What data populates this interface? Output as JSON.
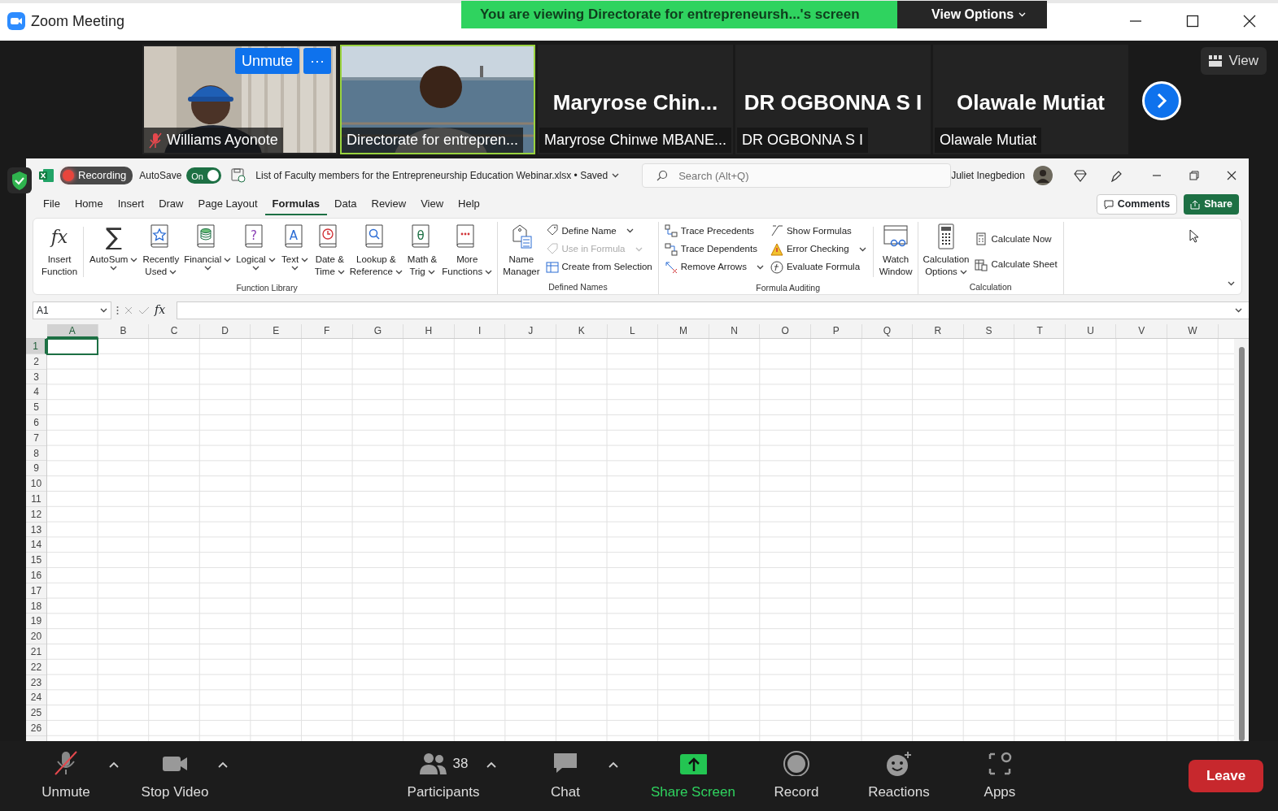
{
  "window": {
    "title": "Zoom Meeting"
  },
  "share_banner": {
    "text": "You are viewing Directorate for entrepreneursh...'s screen",
    "view_options": "View Options"
  },
  "participants": [
    {
      "kind": "video",
      "name": "Williams Ayonote",
      "muted": true,
      "active_speaker": false,
      "buttons": [
        "Unmute",
        "···"
      ]
    },
    {
      "kind": "video",
      "name": "Directorate for entrepren...",
      "muted": false,
      "active_speaker": true
    },
    {
      "kind": "name",
      "title": "Maryrose  Chin...",
      "name": "Maryrose Chinwe MBANE...",
      "muted": false,
      "active_speaker": false
    },
    {
      "kind": "name",
      "title": "DR OGBONNA S I",
      "name": "DR OGBONNA S I",
      "muted": false,
      "active_speaker": false
    },
    {
      "kind": "name",
      "title": "Olawale Mutiat",
      "name": "Olawale Mutiat",
      "muted": false,
      "active_speaker": false
    }
  ],
  "view_button": "View",
  "shared_screen": {
    "recording": "Recording",
    "excel": {
      "autosave": {
        "label": "AutoSave",
        "on": true,
        "state": "On"
      },
      "document_title": "List of Faculty members for the Entrepreneurship Education Webinar.xlsx • Saved",
      "search": {
        "placeholder": "Search (Alt+Q)"
      },
      "user": "Juliet Inegbedion",
      "tabs": [
        {
          "label": "File",
          "selected": false
        },
        {
          "label": "Home",
          "selected": false
        },
        {
          "label": "Insert",
          "selected": false
        },
        {
          "label": "Draw",
          "selected": false
        },
        {
          "label": "Page Layout",
          "selected": false
        },
        {
          "label": "Formulas",
          "selected": true
        },
        {
          "label": "Data",
          "selected": false
        },
        {
          "label": "Review",
          "selected": false
        },
        {
          "label": "View",
          "selected": false
        },
        {
          "label": "Help",
          "selected": false
        }
      ],
      "comments": "Comments",
      "share": "Share",
      "ribbon": [
        {
          "title": "Function Library",
          "items": [
            {
              "kind": "large",
              "label": [
                "Insert",
                "Function"
              ],
              "dropdown": false,
              "glyph": "fx"
            },
            {
              "kind": "separator"
            },
            {
              "kind": "large",
              "label": [
                "AutoSum"
              ],
              "dropdown": true,
              "glyph": "∑"
            },
            {
              "kind": "large",
              "label": [
                "Recently",
                "Used"
              ],
              "dropdown": true
            },
            {
              "kind": "large",
              "label": [
                "Financial"
              ],
              "dropdown": true
            },
            {
              "kind": "large",
              "label": [
                "Logical"
              ],
              "dropdown": true,
              "glyph": "?"
            },
            {
              "kind": "large",
              "label": [
                "Text"
              ],
              "dropdown": true,
              "glyph": "A"
            },
            {
              "kind": "large",
              "label": [
                "Date &",
                "Time"
              ],
              "dropdown": true
            },
            {
              "kind": "large",
              "label": [
                "Lookup &",
                "Reference"
              ],
              "dropdown": true
            },
            {
              "kind": "large",
              "label": [
                "Math &",
                "Trig"
              ],
              "dropdown": true,
              "glyph": "θ"
            },
            {
              "kind": "large",
              "label": [
                "More",
                "Functions"
              ],
              "dropdown": true
            }
          ]
        },
        {
          "title": "Defined Names",
          "items": [
            {
              "kind": "large",
              "label": [
                "Name",
                "Manager"
              ],
              "dropdown": false
            },
            {
              "kind": "stack",
              "items": [
                {
                  "label": "Define Name",
                  "dropdown": true,
                  "disabled": false
                },
                {
                  "label": "Use in Formula",
                  "dropdown": true,
                  "disabled": true
                },
                {
                  "label": "Create from Selection",
                  "dropdown": false,
                  "disabled": false
                }
              ]
            }
          ]
        },
        {
          "title": "Formula Auditing",
          "items": [
            {
              "kind": "stack",
              "items": [
                {
                  "label": "Trace Precedents",
                  "dropdown": false,
                  "disabled": false
                },
                {
                  "label": "Trace Dependents",
                  "dropdown": false,
                  "disabled": false
                },
                {
                  "label": "Remove Arrows",
                  "dropdown": true,
                  "disabled": false
                }
              ]
            },
            {
              "kind": "stack",
              "items": [
                {
                  "label": "Show Formulas",
                  "dropdown": false,
                  "disabled": false
                },
                {
                  "label": "Error Checking",
                  "dropdown": true,
                  "disabled": false
                },
                {
                  "label": "Evaluate Formula",
                  "dropdown": false,
                  "disabled": false
                }
              ]
            },
            {
              "kind": "separator"
            },
            {
              "kind": "large",
              "label": [
                "Watch",
                "Window"
              ],
              "dropdown": false
            }
          ]
        },
        {
          "title": "Calculation",
          "items": [
            {
              "kind": "large",
              "label": [
                "Calculation",
                "Options"
              ],
              "dropdown": true
            },
            {
              "kind": "stack",
              "items": [
                {
                  "label": "Calculate Now",
                  "dropdown": false,
                  "disabled": false
                },
                {
                  "label": "Calculate Sheet",
                  "dropdown": false,
                  "disabled": false
                }
              ]
            }
          ]
        }
      ],
      "name_box": "A1",
      "formula_glyph": "fx",
      "columns": [
        {
          "label": "A",
          "selected": true
        },
        {
          "label": "B",
          "selected": false
        },
        {
          "label": "C",
          "selected": false
        },
        {
          "label": "D",
          "selected": false
        },
        {
          "label": "E",
          "selected": false
        },
        {
          "label": "F",
          "selected": false
        },
        {
          "label": "G",
          "selected": false
        },
        {
          "label": "H",
          "selected": false
        },
        {
          "label": "I",
          "selected": false
        },
        {
          "label": "J",
          "selected": false
        },
        {
          "label": "K",
          "selected": false
        },
        {
          "label": "L",
          "selected": false
        },
        {
          "label": "M",
          "selected": false
        },
        {
          "label": "N",
          "selected": false
        },
        {
          "label": "O",
          "selected": false
        },
        {
          "label": "P",
          "selected": false
        },
        {
          "label": "Q",
          "selected": false
        },
        {
          "label": "R",
          "selected": false
        },
        {
          "label": "S",
          "selected": false
        },
        {
          "label": "T",
          "selected": false
        },
        {
          "label": "U",
          "selected": false
        },
        {
          "label": "V",
          "selected": false
        },
        {
          "label": "W",
          "selected": false
        }
      ],
      "rows": [
        {
          "label": "1",
          "selected": true
        },
        {
          "label": "2",
          "selected": false
        },
        {
          "label": "3",
          "selected": false
        },
        {
          "label": "4",
          "selected": false
        },
        {
          "label": "5",
          "selected": false
        },
        {
          "label": "6",
          "selected": false
        },
        {
          "label": "7",
          "selected": false
        },
        {
          "label": "8",
          "selected": false
        },
        {
          "label": "9",
          "selected": false
        },
        {
          "label": "10",
          "selected": false
        },
        {
          "label": "11",
          "selected": false
        },
        {
          "label": "12",
          "selected": false
        },
        {
          "label": "13",
          "selected": false
        },
        {
          "label": "14",
          "selected": false
        },
        {
          "label": "15",
          "selected": false
        },
        {
          "label": "16",
          "selected": false
        },
        {
          "label": "17",
          "selected": false
        },
        {
          "label": "18",
          "selected": false
        },
        {
          "label": "19",
          "selected": false
        },
        {
          "label": "20",
          "selected": false
        },
        {
          "label": "21",
          "selected": false
        },
        {
          "label": "22",
          "selected": false
        },
        {
          "label": "23",
          "selected": false
        },
        {
          "label": "24",
          "selected": false
        },
        {
          "label": "25",
          "selected": false
        },
        {
          "label": "26",
          "selected": false
        }
      ]
    }
  },
  "toolbar": {
    "items": [
      {
        "kind": "mic",
        "label": "Unmute",
        "muted": true,
        "menu": true
      },
      {
        "kind": "video",
        "label": "Stop Video",
        "menu": true
      },
      {
        "kind": "participants",
        "label": "Participants",
        "count": "38",
        "menu": true
      },
      {
        "kind": "chat",
        "label": "Chat",
        "menu": true
      },
      {
        "kind": "share",
        "label": "Share Screen",
        "menu": false
      },
      {
        "kind": "record",
        "label": "Record",
        "menu": false
      },
      {
        "kind": "reactions",
        "label": "Reactions",
        "menu": false
      },
      {
        "kind": "apps",
        "label": "Apps",
        "menu": false
      }
    ],
    "leave": "Leave"
  }
}
